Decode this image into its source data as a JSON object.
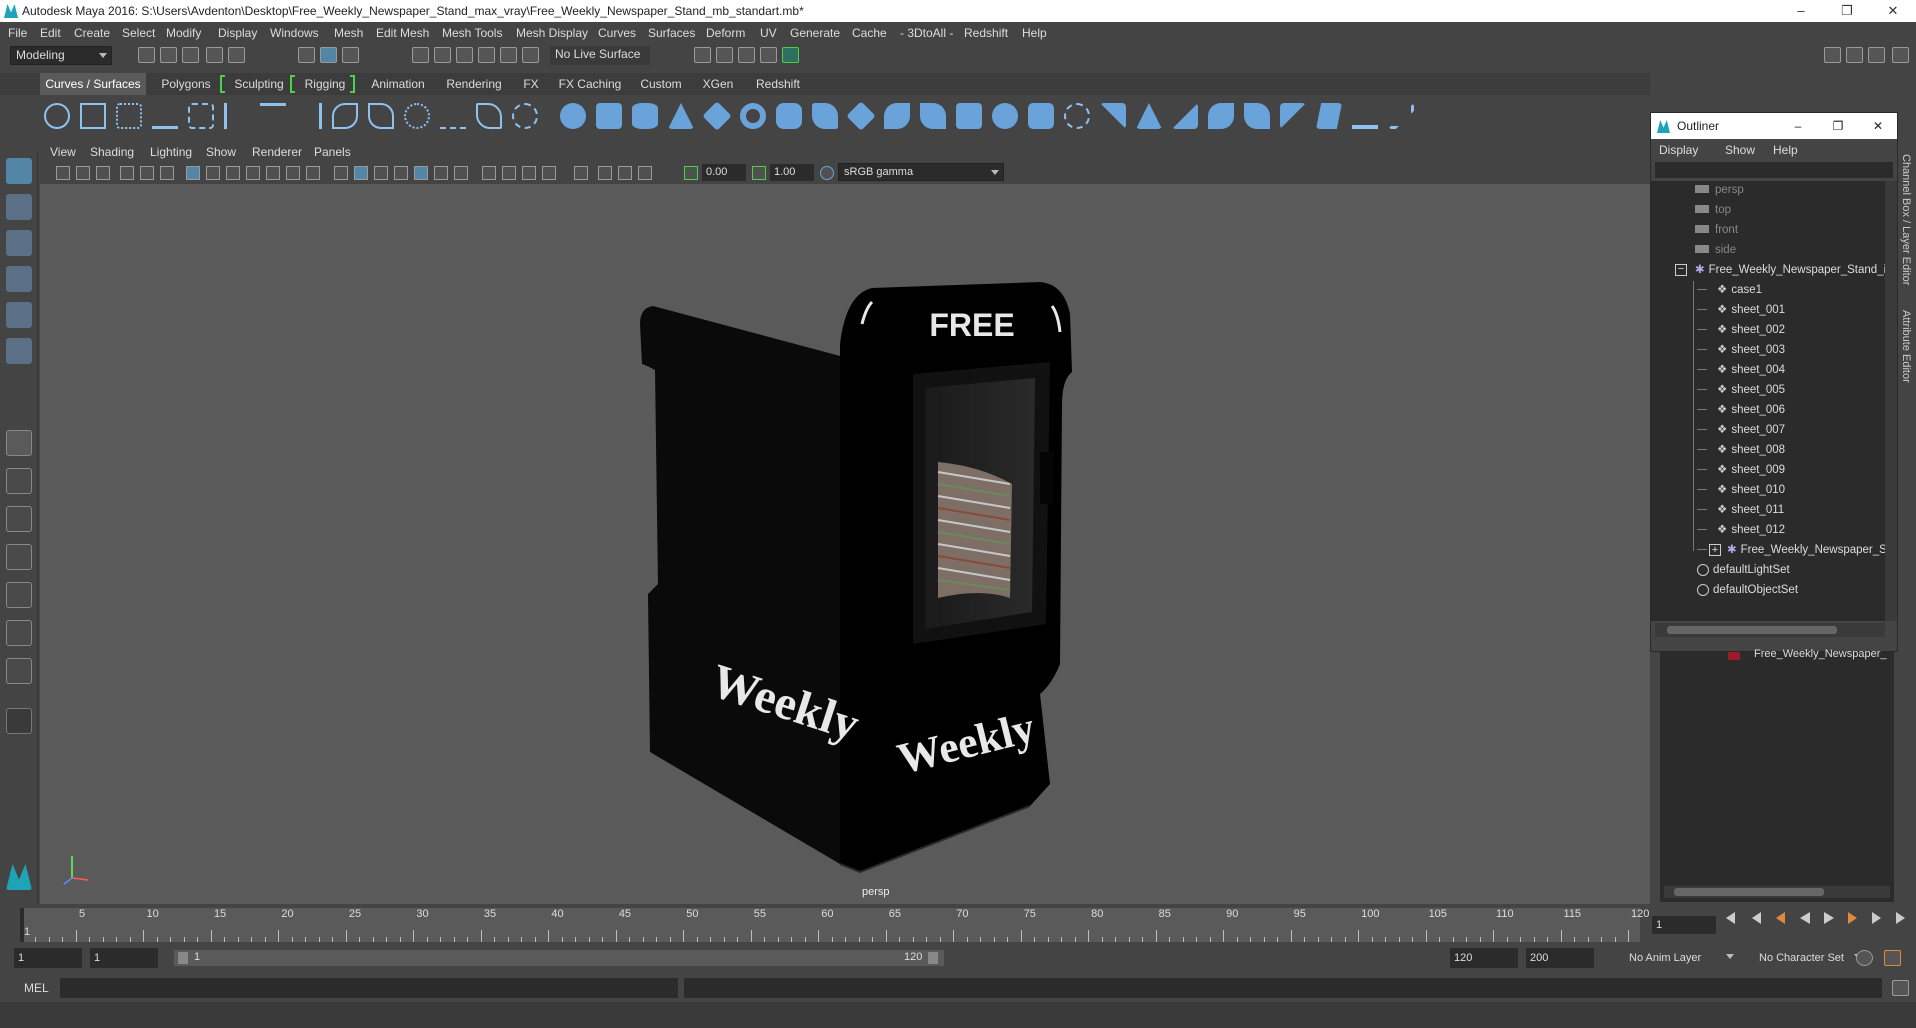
{
  "window": {
    "title": "Autodesk Maya 2016: S:\\Users\\Avdenton\\Desktop\\Free_Weekly_Newspaper_Stand_max_vray\\Free_Weekly_Newspaper_Stand_mb_standart.mb*",
    "minimize": "–",
    "maximize": "❐",
    "close": "✕"
  },
  "menubar": [
    "File",
    "Edit",
    "Create",
    "Select",
    "Modify",
    "Display",
    "Windows",
    "Mesh",
    "Edit Mesh",
    "Mesh Tools",
    "Mesh Display",
    "Curves",
    "Surfaces",
    "Deform",
    "UV",
    "Generate",
    "Cache",
    "- 3DtoAll -",
    "Redshift",
    "Help"
  ],
  "statusline": {
    "mode": "Modeling",
    "live_surface": "No Live Surface"
  },
  "shelf_tabs": [
    "Curves / Surfaces",
    "Polygons",
    "Sculpting",
    "Rigging",
    "Animation",
    "Rendering",
    "FX",
    "FX Caching",
    "Custom",
    "XGen",
    "Redshift"
  ],
  "viewport": {
    "menu": [
      "View",
      "Shading",
      "Lighting",
      "Show",
      "Renderer",
      "Panels"
    ],
    "exposure": "0.00",
    "gamma": "1.00",
    "colorspace": "sRGB gamma",
    "camera_label": "persp",
    "model_text": {
      "top": "FREE",
      "side_left": "Weekly",
      "side_right": "Weekly"
    }
  },
  "outliner": {
    "title": "Outliner",
    "menu": [
      "Display",
      "Show",
      "Help"
    ],
    "cameras": [
      "persp",
      "top",
      "front",
      "side"
    ],
    "group": "Free_Weekly_Newspaper_Stand_i",
    "children": [
      "case1",
      "sheet_001",
      "sheet_002",
      "sheet_003",
      "sheet_004",
      "sheet_005",
      "sheet_006",
      "sheet_007",
      "sheet_008",
      "sheet_009",
      "sheet_010",
      "sheet_011",
      "sheet_012"
    ],
    "subgroup": "Free_Weekly_Newspaper_Sta",
    "sets": [
      "defaultLightSet",
      "defaultObjectSet"
    ],
    "lower_item": "Free_Weekly_Newspaper_"
  },
  "side_tabs": [
    "Channel Box / Layer Editor",
    "Attribute Editor"
  ],
  "timeline": {
    "ticks": [
      "1",
      "5",
      "10",
      "15",
      "20",
      "25",
      "30",
      "35",
      "40",
      "45",
      "50",
      "55",
      "60",
      "65",
      "70",
      "75",
      "80",
      "85",
      "90",
      "95",
      "100",
      "105",
      "110",
      "115",
      "120"
    ],
    "current_frame": "1"
  },
  "range": {
    "start": "1",
    "playback_start": "1",
    "slider_start": "1",
    "slider_end": "120",
    "playback_end": "120",
    "end": "200",
    "anim_layer": "No Anim Layer",
    "character_set": "No Character Set"
  },
  "command": {
    "label": "MEL"
  }
}
